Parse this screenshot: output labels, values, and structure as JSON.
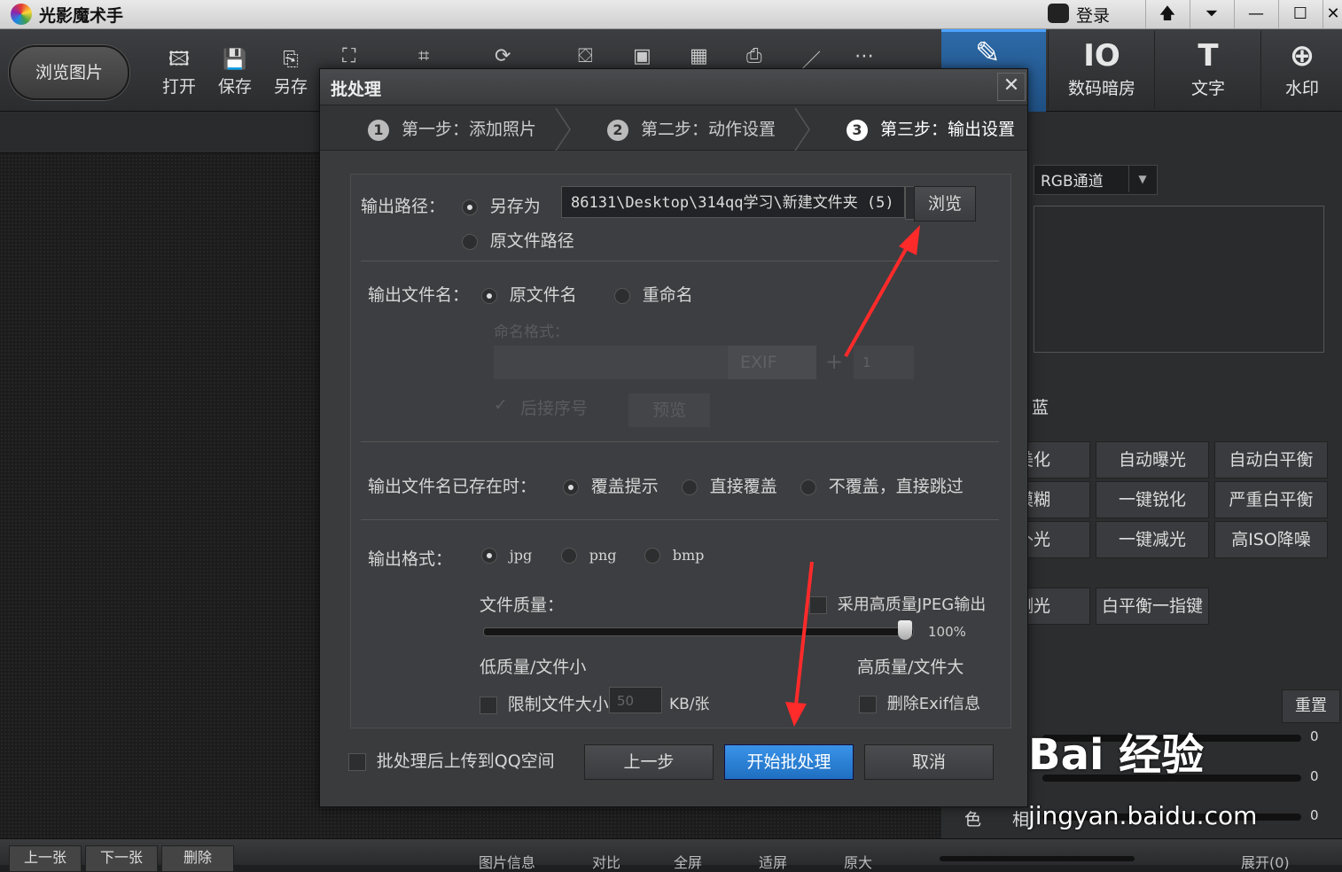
{
  "titlebar": {
    "title": "光影魔术手",
    "login": "登录",
    "controls": [
      "🡅",
      "⏷",
      "—",
      "☐",
      "✕"
    ]
  },
  "toolbar": {
    "browse": "浏览图片",
    "tools": [
      {
        "label": "打开",
        "icon": "🖾"
      },
      {
        "label": "保存",
        "icon": "💾"
      },
      {
        "label": "另存",
        "icon": "⎘"
      }
    ],
    "right_tools": [
      {
        "label": "",
        "icon": "✎"
      },
      {
        "label": "数码暗房",
        "icon": "IO"
      },
      {
        "label": "文字",
        "icon": "T"
      },
      {
        "label": "水印",
        "icon": "⊕"
      }
    ]
  },
  "right_panel": {
    "channel": "RGB通道",
    "section_char": "蓝",
    "buttons": [
      [
        "美化",
        "自动曝光",
        "自动白平衡"
      ],
      [
        "模糊",
        "一键锐化",
        "严重白平衡"
      ],
      [
        "补光",
        "一键减光",
        "高ISO降噪"
      ],
      [
        "测光",
        "白平衡一指键"
      ]
    ],
    "reset": "重置",
    "slider_values": [
      "0",
      "0",
      "0"
    ],
    "bottom_labels": [
      "色",
      "相"
    ]
  },
  "bottombar": {
    "buttons": [
      "上一张",
      "下一张",
      "删除"
    ],
    "items": [
      "图片信息",
      "对比",
      "全屏",
      "适屏",
      "原大",
      "展开(0)"
    ]
  },
  "dialog": {
    "title": "批处理",
    "close": "✕",
    "steps": [
      {
        "num": "1",
        "label": "第一步：添加照片"
      },
      {
        "num": "2",
        "label": "第二步：动作设置"
      },
      {
        "num": "3",
        "label": "第三步：输出设置"
      }
    ],
    "output_path": {
      "label": "输出路径：",
      "option_saveas": "另存为",
      "option_original": "原文件路径",
      "path": "86131\\Desktop\\314qq学习\\新建文件夹 (5)",
      "browse": "浏览"
    },
    "output_name": {
      "label": "输出文件名：",
      "option_original": "原文件名",
      "option_rename": "重命名",
      "format_label": "命名格式：",
      "exif": "EXIF",
      "plus": "+",
      "start_num": "1",
      "suffix": "后接序号",
      "preview": "预览"
    },
    "exists": {
      "label": "输出文件名已存在时：",
      "opt1": "覆盖提示",
      "opt2": "直接覆盖",
      "opt3": "不覆盖，直接跳过"
    },
    "format": {
      "label": "输出格式：",
      "jpg": "jpg",
      "png": "png",
      "bmp": "bmp",
      "quality_label": "文件质量：",
      "hq_jpeg": "采用高质量JPEG输出",
      "quality_value": "100%",
      "quality_fraction": 1.0,
      "low": "低质量/文件小",
      "high": "高质量/文件大",
      "limit_size": "限制文件大小",
      "limit_value": "50",
      "unit": "KB/张",
      "delete_exif": "删除Exif信息"
    },
    "upload_qq": "批处理后上传到QQ空间",
    "prev": "上一步",
    "start": "开始批处理",
    "cancel": "取消"
  },
  "watermark": {
    "brand": "Bai 经验",
    "url": "jingyan.baidu.com"
  },
  "colors": {
    "accent": "#1f6fc2",
    "arrow": "#ff2a2a"
  }
}
